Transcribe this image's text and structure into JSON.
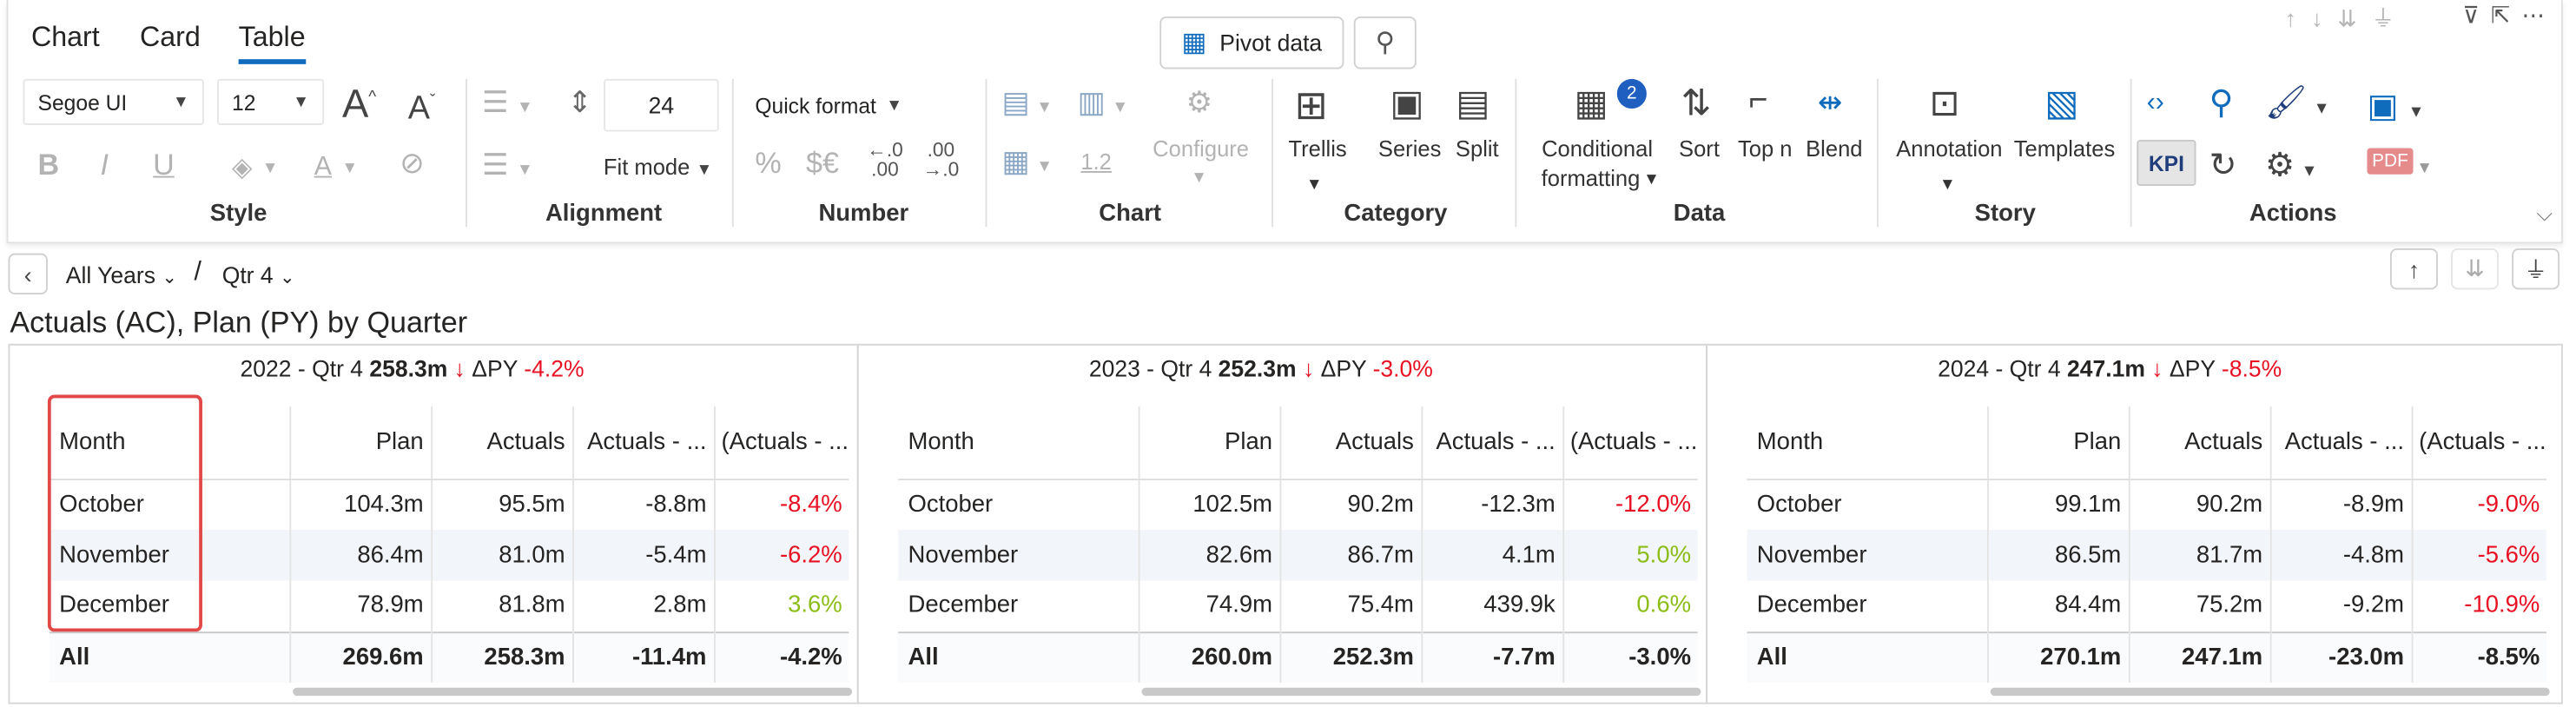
{
  "tabs": [
    "Chart",
    "Card",
    "Table"
  ],
  "top_buttons": {
    "pivot": "Pivot data"
  },
  "style": {
    "font": "Segoe UI",
    "size": "12",
    "label": "Style"
  },
  "alignment": {
    "line_height": "24",
    "fit": "Fit mode",
    "label": "Alignment"
  },
  "number": {
    "quick": "Quick format",
    "label": "Number",
    "decrease": ".0",
    "decrease2": ".00",
    "increase": ".00",
    "increase2": ".0"
  },
  "chart": {
    "configure": "Configure",
    "decimal": "1.2",
    "label": "Chart"
  },
  "category": {
    "trellis": "Trellis",
    "series": "Series",
    "split": "Split",
    "label": "Category"
  },
  "data": {
    "cond": "Conditional",
    "cond2": "formatting",
    "badge": "2",
    "sort": "Sort",
    "topn": "Top n",
    "blend": "Blend",
    "label": "Data"
  },
  "story": {
    "annotation": "Annotation",
    "templates": "Templates",
    "label": "Story"
  },
  "actions": {
    "kpi": "KPI",
    "label": "Actions",
    "pdf": "PDF"
  },
  "breadcrumb": {
    "level1": "All Years",
    "separator": "/",
    "level2": "Qtr 4"
  },
  "title": "Actuals (AC), Plan (PY) by Quarter",
  "columns": [
    "Month",
    "Plan",
    "Actuals",
    "Actuals - ...",
    "(Actuals - ..."
  ],
  "panels": [
    {
      "period": "2022 - Qtr 4",
      "value": "258.3m",
      "delta_label": "ΔPY",
      "delta": "-4.2%",
      "rows": [
        [
          "October",
          "104.3m",
          "95.5m",
          "-8.8m",
          "-8.4%"
        ],
        [
          "November",
          "86.4m",
          "81.0m",
          "-5.4m",
          "-6.2%"
        ],
        [
          "December",
          "78.9m",
          "81.8m",
          "2.8m",
          "3.6%"
        ]
      ],
      "total": [
        "All",
        "269.6m",
        "258.3m",
        "-11.4m",
        "-4.2%"
      ]
    },
    {
      "period": "2023 - Qtr 4",
      "value": "252.3m",
      "delta_label": "ΔPY",
      "delta": "-3.0%",
      "rows": [
        [
          "October",
          "102.5m",
          "90.2m",
          "-12.3m",
          "-12.0%"
        ],
        [
          "November",
          "82.6m",
          "86.7m",
          "4.1m",
          "5.0%"
        ],
        [
          "December",
          "74.9m",
          "75.4m",
          "439.9k",
          "0.6%"
        ]
      ],
      "total": [
        "All",
        "260.0m",
        "252.3m",
        "-7.7m",
        "-3.0%"
      ]
    },
    {
      "period": "2024 - Qtr 4",
      "value": "247.1m",
      "delta_label": "ΔPY",
      "delta": "-8.5%",
      "rows": [
        [
          "October",
          "99.1m",
          "90.2m",
          "-8.9m",
          "-9.0%"
        ],
        [
          "November",
          "86.5m",
          "81.7m",
          "-4.8m",
          "-5.6%"
        ],
        [
          "December",
          "84.4m",
          "75.2m",
          "-9.2m",
          "-10.9%"
        ]
      ],
      "total": [
        "All",
        "270.1m",
        "247.1m",
        "-23.0m",
        "-8.5%"
      ]
    }
  ],
  "colors": {
    "negative": "#e81123",
    "positive": "#8cbd18",
    "accent": "#0f6cbd",
    "highlight": "#e24848"
  }
}
